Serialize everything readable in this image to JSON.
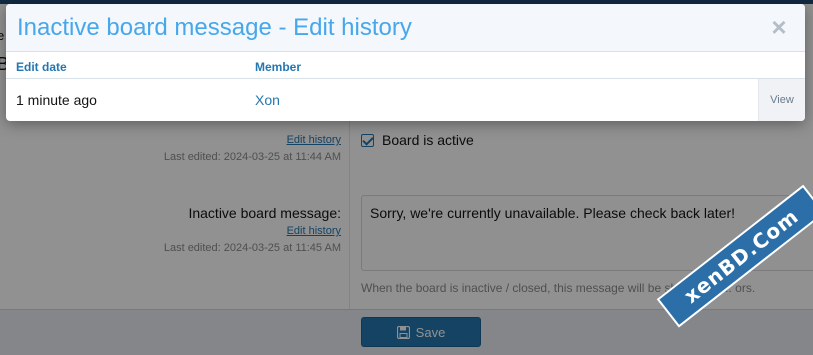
{
  "background_form": {
    "edge_glyph_1": "e",
    "edge_glyph_2": "B",
    "row1": {
      "edit_history_link": "Edit history",
      "last_edited": "Last edited: 2024-03-25 at 11:44 AM",
      "checkbox_label": "Board is active",
      "checked": true
    },
    "row2": {
      "label": "Inactive board message:",
      "edit_history_link": "Edit history",
      "last_edited": "Last edited: 2024-03-25 at 11:45 AM",
      "textarea_value": "Sorry, we're currently unavailable. Please check back later!",
      "hint": "When the board is inactive / closed, this message will be shown to s... ors."
    },
    "save_button_label": "Save"
  },
  "modal": {
    "title": "Inactive board message - Edit history",
    "close_symbol": "×",
    "columns": [
      "Edit date",
      "Member"
    ],
    "rows": [
      {
        "date": "1 minute ago",
        "member": "Xon",
        "action": "View"
      }
    ]
  },
  "watermark": "xenBD.Com",
  "colors": {
    "accent": "#2577b1",
    "title": "#47a7eb",
    "save_button": "#2577b1"
  }
}
